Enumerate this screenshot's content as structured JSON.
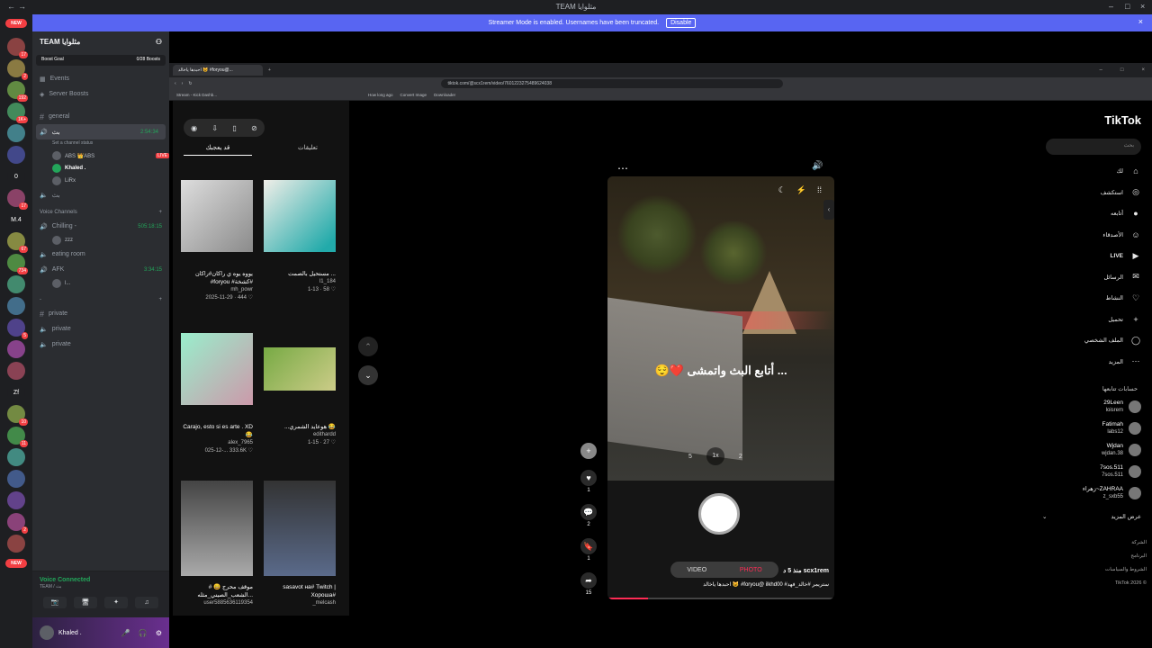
{
  "window": {
    "title": "TEAM مثلوايا"
  },
  "banner": {
    "text": "Streamer Mode is enabled. Usernames have been truncated.",
    "button": "Disable"
  },
  "servers": [
    {
      "label": "",
      "badge": "17"
    },
    {
      "label": "",
      "badge": "2"
    },
    {
      "label": "",
      "badge": "192"
    },
    {
      "label": "",
      "badge": "1K+"
    },
    {
      "label": "",
      "badge": ""
    },
    {
      "label": "",
      "badge": ""
    },
    {
      "label": "0",
      "badge": ""
    },
    {
      "label": "",
      "badge": "17"
    },
    {
      "label": "M.4",
      "badge": ""
    },
    {
      "label": "",
      "badge": "67"
    },
    {
      "label": "",
      "badge": "734"
    },
    {
      "label": "",
      "badge": ""
    },
    {
      "label": "",
      "badge": ""
    },
    {
      "label": "",
      "badge": "5"
    },
    {
      "label": "",
      "badge": ""
    },
    {
      "label": "",
      "badge": ""
    },
    {
      "label": "Zf",
      "badge": ""
    },
    {
      "label": "",
      "badge": "10"
    },
    {
      "label": "",
      "badge": "11"
    },
    {
      "label": "",
      "badge": ""
    },
    {
      "label": "",
      "badge": ""
    },
    {
      "label": "",
      "badge": ""
    },
    {
      "label": "",
      "badge": "2"
    },
    {
      "label": "",
      "badge": ""
    }
  ],
  "new_tag": "NEW",
  "guild": {
    "name": "TEAM مثلوايا",
    "boost_label": "Boost Goal",
    "boost_count": "0/28 Boosts"
  },
  "nav": {
    "events": "Events",
    "server_boosts": "Server Boosts"
  },
  "text_channels": [
    {
      "name": "general"
    }
  ],
  "stream_channel": {
    "name": "بث",
    "time": "2:54:34",
    "status": "Set a channel status",
    "members": [
      {
        "name": "ABS 👑ABS",
        "live": "LIVE"
      },
      {
        "name": "Khaled .",
        "live": ""
      },
      {
        "name": "LiRx",
        "live": ""
      }
    ]
  },
  "extra_channel": "بث",
  "voice_category": "Voice Channels",
  "voice_channels": [
    {
      "name": "Chilling -",
      "time": "505:18:15",
      "member": "zzz"
    },
    {
      "name": "eating room",
      "time": "",
      "member": ""
    },
    {
      "name": "AFK",
      "time": "3:34:15",
      "member": "l..."
    }
  ],
  "private_category": "-",
  "private_channels": [
    "private",
    "private",
    "private"
  ],
  "voice": {
    "status": "Voice Connected",
    "sub": "TEAM / بث"
  },
  "user": {
    "name": "Khaled ."
  },
  "browser": {
    "tab_title": "احبدها ياخالد 😺 #foryou@...",
    "url": "tiktok.com/@scx1rem/video/7601223275489624038",
    "bookmarks": [
      "Stream - Kick Dashb...",
      "How long ago",
      "Convert Image",
      "Downloader"
    ]
  },
  "tiktok": {
    "logo": "TikTok",
    "search_placeholder": "بحث",
    "nav": [
      {
        "label": "لك",
        "icon": "⌂"
      },
      {
        "label": "استكشف",
        "icon": "◎"
      },
      {
        "label": "أتابعه",
        "icon": "●"
      },
      {
        "label": "الأصدقاء",
        "icon": "☺"
      },
      {
        "label": "LIVE",
        "icon": "▶"
      },
      {
        "label": "الرسائل",
        "icon": "✉"
      },
      {
        "label": "النشاط",
        "icon": "♡"
      },
      {
        "label": "تحميل",
        "icon": "+"
      },
      {
        "label": "الملف الشخصي",
        "icon": "◯"
      },
      {
        "label": "المزيد",
        "icon": "⋯"
      }
    ],
    "following_header": "حسابات تتابعها",
    "following": [
      {
        "name": "29Leen",
        "handle": "loisrem"
      },
      {
        "name": "Fatimah",
        "handle": "labs12"
      },
      {
        "name": "Wjdan",
        "handle": "wjdan.38"
      },
      {
        "name": "7sos.511",
        "handle": "7sos.511"
      },
      {
        "name": "ZAHRAA~زهراء",
        "handle": "z_sxb55"
      }
    ],
    "see_more": "عرض المزيد",
    "footer": [
      "الشركة",
      "البرنامج",
      "الشروط والسياسات",
      "© TikTok 2026"
    ],
    "tabs": {
      "active": "قد يعجبك",
      "other": "تعليقات"
    },
    "grid": [
      {
        "caption": "يووه يوه ي راكان#راكان #foryou #كشخة#",
        "author": "mh_powr",
        "meta": "2025-11-29 · 444 ♡"
      },
      {
        "caption": "مستحيل بالصمت ...",
        "author": "l1_184",
        "meta": "1-13 · 58 ♡"
      },
      {
        "caption": "Carajo, esto si es arte . XD 😂",
        "author": "alex_7965",
        "meta": "025-12-... 333.6K ♡"
      },
      {
        "caption": "...هوعايد الشمري 😂",
        "author": "edithardd",
        "meta": "1-15 · 27 ♡"
      },
      {
        "caption": "# 😄 موقف محرج الشعب_الصيني_مثله...",
        "author": "user5885636119354",
        "meta": ""
      },
      {
        "caption": "sasavot на# Twitch | Хороша#",
        "author": "_melcash",
        "meta": ""
      }
    ],
    "video": {
      "overlay_text": "😌❤️ أتابع البث واتمشى ...",
      "zoom": [
        "5",
        "1x",
        "2"
      ],
      "modes": [
        "VIDEO",
        "PHOTO"
      ],
      "author": "scx1rem",
      "when": "منذ 5 د",
      "description": "احبدها ياخالد 😺 #foryou@ ilkhd00 #ستريمر #خالد_فهد",
      "likes": "1",
      "comments": "2",
      "saves": "1",
      "shares": "15",
      "progress": 0.18
    }
  }
}
